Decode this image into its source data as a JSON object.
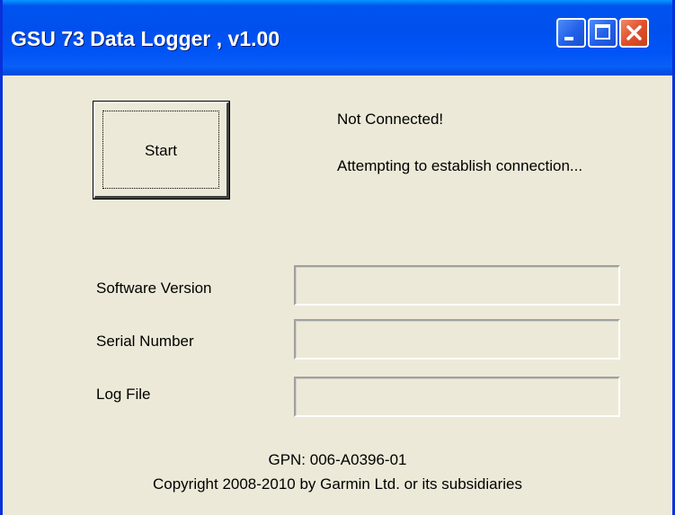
{
  "window": {
    "title": "GSU 73 Data Logger , v1.00",
    "controls": {
      "minimize_icon": "minimize-icon",
      "maximize_icon": "maximize-icon",
      "close_icon": "close-icon"
    },
    "colors": {
      "titlebar": "#0053ee",
      "close": "#e0512c",
      "background": "#ece9d8"
    }
  },
  "main": {
    "start_button_label": "Start",
    "status_line_1": "Not Connected!",
    "status_line_2": "Attempting to establish connection...",
    "fields": {
      "software_version": {
        "label": "Software Version",
        "value": ""
      },
      "serial_number": {
        "label": "Serial Number",
        "value": ""
      },
      "log_file": {
        "label": "Log File",
        "value": ""
      }
    }
  },
  "footer": {
    "gpn": "GPN: 006-A0396-01",
    "copyright": "Copyright 2008-2010 by Garmin Ltd. or its subsidiaries"
  }
}
